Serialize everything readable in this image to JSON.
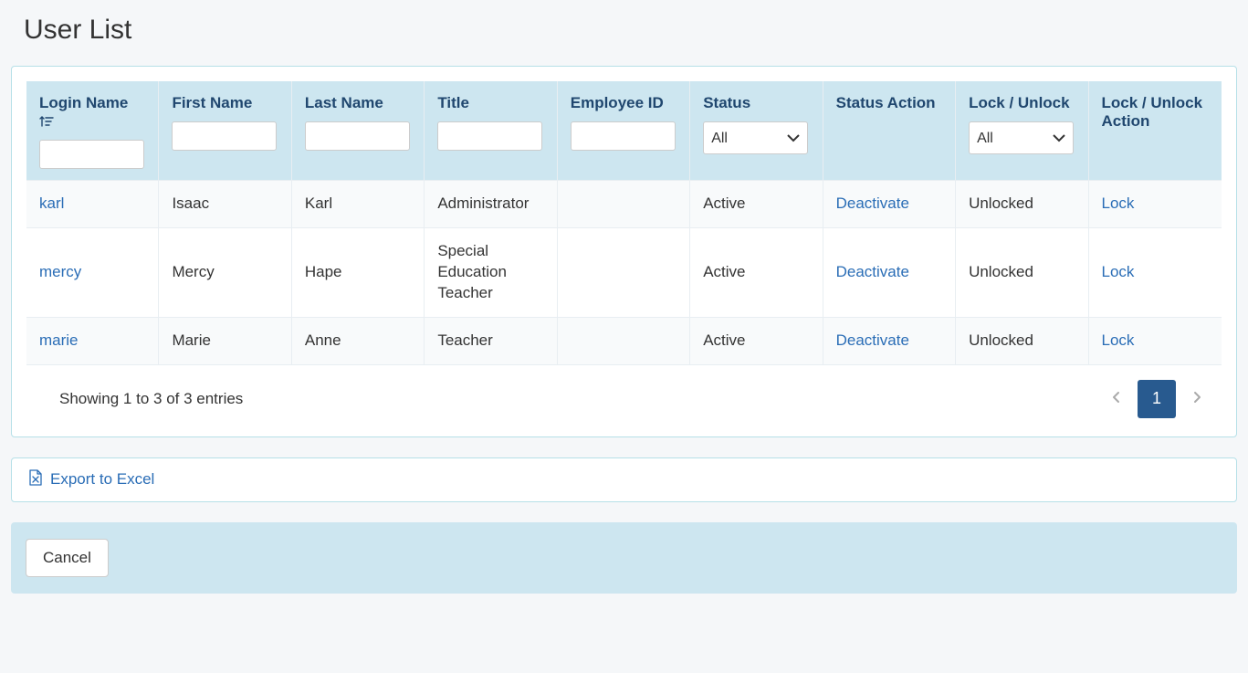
{
  "page": {
    "title": "User List"
  },
  "table": {
    "headers": {
      "login_name": "Login Name",
      "first_name": "First Name",
      "last_name": "Last Name",
      "title": "Title",
      "employee_id": "Employee ID",
      "status": "Status",
      "status_action": "Status Action",
      "lock_unlock": "Lock / Unlock",
      "lock_unlock_action": "Lock / Unlock Action"
    },
    "filters": {
      "status_options": [
        "All"
      ],
      "status_selected": "All",
      "lock_options": [
        "All"
      ],
      "lock_selected": "All"
    },
    "rows": [
      {
        "login_name": "karl",
        "first_name": "Isaac",
        "last_name": "Karl",
        "title": "Administrator",
        "employee_id": "",
        "status": "Active",
        "status_action": "Deactivate",
        "lock_unlock": "Unlocked",
        "lock_action": "Lock"
      },
      {
        "login_name": "mercy",
        "first_name": "Mercy",
        "last_name": "Hape",
        "title": "Special Education Teacher",
        "employee_id": "",
        "status": "Active",
        "status_action": "Deactivate",
        "lock_unlock": "Unlocked",
        "lock_action": "Lock"
      },
      {
        "login_name": "marie",
        "first_name": "Marie",
        "last_name": "Anne",
        "title": "Teacher",
        "employee_id": "",
        "status": "Active",
        "status_action": "Deactivate",
        "lock_unlock": "Unlocked",
        "lock_action": "Lock"
      }
    ],
    "summary": "Showing 1 to 3 of 3 entries",
    "pager": {
      "current": "1"
    }
  },
  "export": {
    "label": "Export to Excel"
  },
  "actions": {
    "cancel": "Cancel"
  }
}
